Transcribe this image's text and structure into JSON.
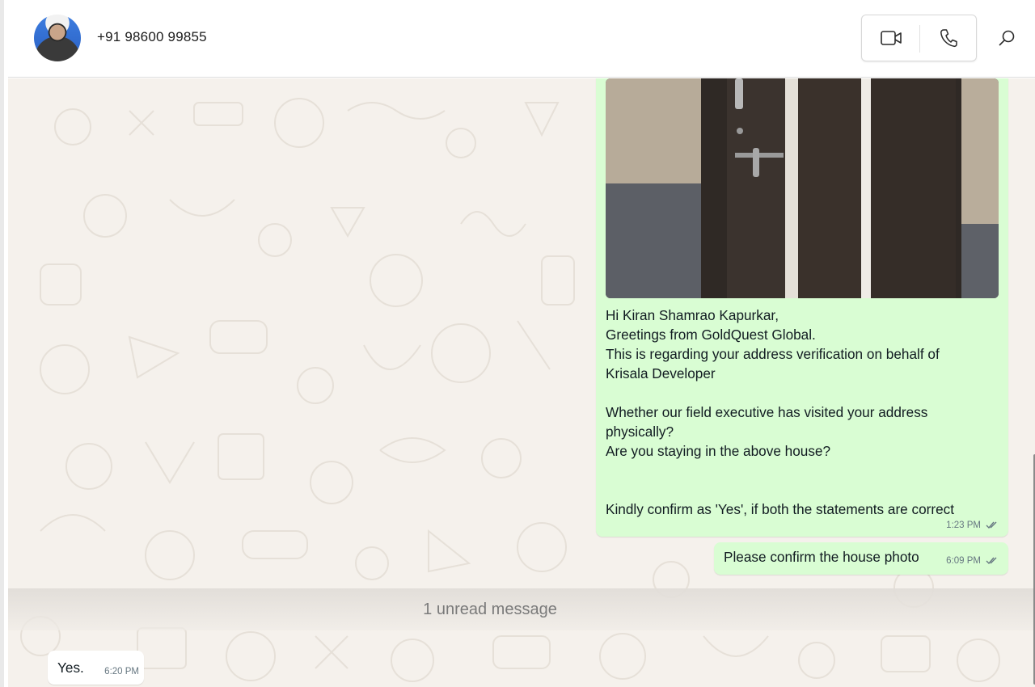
{
  "header": {
    "contact_name": "+91 98600 99855",
    "avatar_icon": "contact-avatar",
    "video_call_icon": "video-camera-icon",
    "voice_call_icon": "phone-icon",
    "search_icon": "search-icon"
  },
  "messages": [
    {
      "direction": "outgoing",
      "has_photo": true,
      "text": "Hi Kiran Shamrao Kapurkar,\nGreetings from GoldQuest Global.\nThis is regarding your address verification on behalf of\nKrisala Developer\n\nWhether our field executive has visited your address\nphysically?\nAre you staying in the above house?\n\n\nKindly confirm as 'Yes', if both the statements are correct",
      "time": "1:23 PM",
      "status_icon": "double-check-icon"
    },
    {
      "direction": "outgoing",
      "text": "Please confirm the house photo",
      "time": "6:09 PM",
      "status_icon": "double-check-icon"
    }
  ],
  "unread_divider": "1 unread message",
  "incoming": {
    "text": "Yes.",
    "time": "6:20 PM"
  },
  "colors": {
    "outgoing_bubble": "#d9fdd3",
    "incoming_bubble": "#ffffff",
    "chat_background": "#f5f1ec"
  }
}
